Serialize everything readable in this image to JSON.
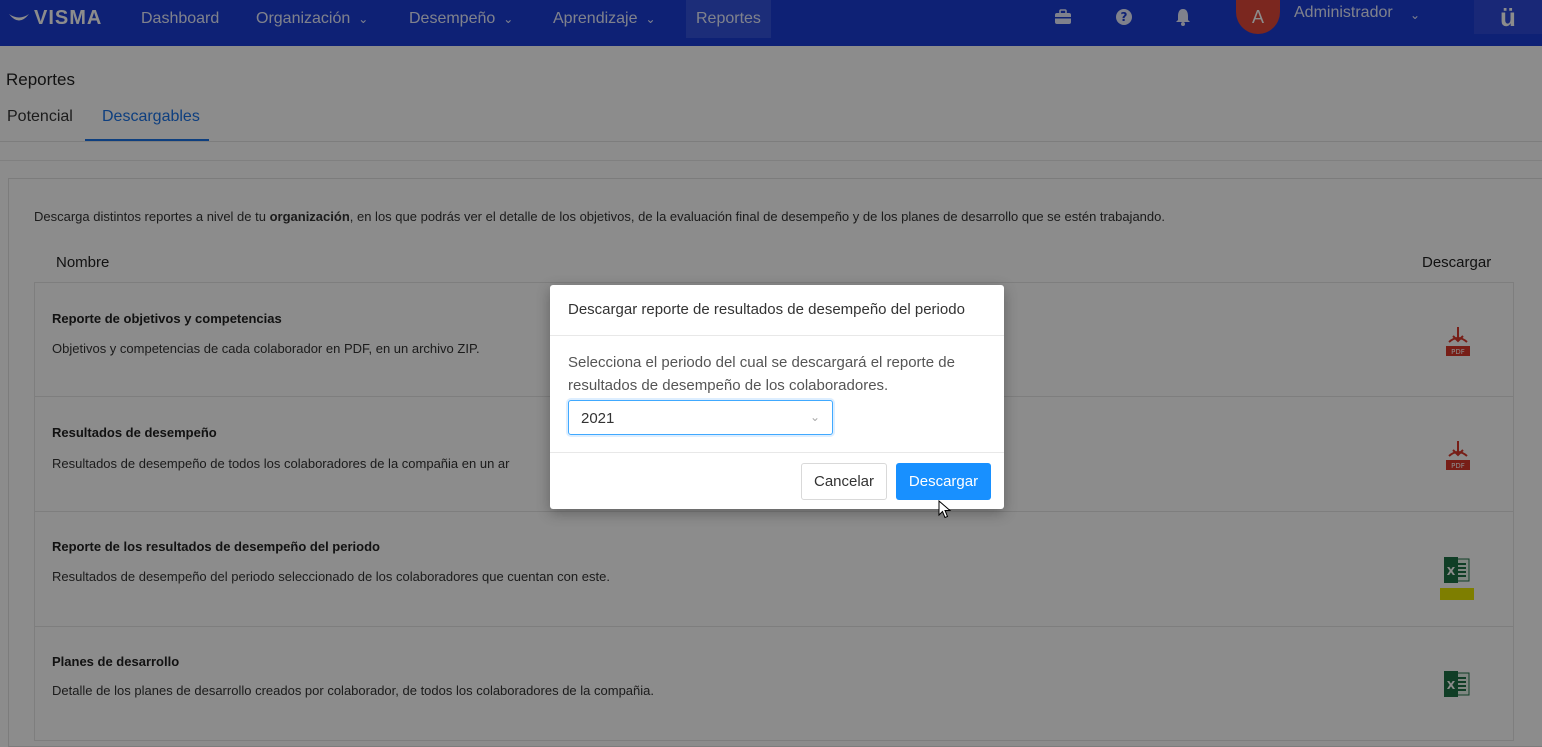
{
  "nav": {
    "logo_text": "VISMA",
    "items": [
      {
        "label": "Dashboard",
        "has_menu": false
      },
      {
        "label": "Organización",
        "has_menu": true
      },
      {
        "label": "Desempeño",
        "has_menu": true
      },
      {
        "label": "Aprendizaje",
        "has_menu": true
      },
      {
        "label": "Reportes",
        "has_menu": false,
        "active": true
      }
    ],
    "icons": [
      "briefcase-icon",
      "help-icon",
      "bell-icon"
    ],
    "avatar_initial": "A",
    "user_name": "Administrador",
    "brand_mark": "ü",
    "colors": {
      "bar": "#1b3dd6",
      "avatar": "#e0473a"
    }
  },
  "page": {
    "title": "Reportes",
    "tabs": [
      {
        "label": "Potencial",
        "active": false
      },
      {
        "label": "Descargables",
        "active": true
      }
    ]
  },
  "content": {
    "intro_before": "Descarga distintos reportes a nivel de tu ",
    "intro_bold": "organización",
    "intro_after": ", en los que podrás ver el detalle de los objetivos, de la evaluación final de desempeño y de los planes de desarrollo que se estén trabajando.",
    "columns": {
      "name": "Nombre",
      "download": "Descargar"
    },
    "reports": [
      {
        "title": "Reporte de objetivos y competencias",
        "description": "Objetivos y competencias de cada colaborador en PDF, en un archivo ZIP.",
        "file_type": "pdf"
      },
      {
        "title": "Resultados de desempeño",
        "description": "Resultados de desempeño de todos los colaboradores de la compañia en un ar",
        "file_type": "pdf"
      },
      {
        "title": "Reporte de los resultados de desempeño del periodo",
        "description": "Resultados de desempeño del periodo seleccionado de los colaboradores que cuentan con este.",
        "file_type": "excel"
      },
      {
        "title": "Planes de desarrollo",
        "description": "Detalle de los planes de desarrollo creados por colaborador, de todos los colaboradores de la compañia.",
        "file_type": "excel"
      }
    ]
  },
  "modal": {
    "title": "Descargar reporte de resultados de desempeño del periodo",
    "body": "Selecciona el periodo del cual se descargará el reporte de resultados de desempeño de los colaboradores.",
    "select_value": "2021",
    "cancel_label": "Cancelar",
    "confirm_label": "Descargar",
    "primary_color": "#1890ff"
  }
}
